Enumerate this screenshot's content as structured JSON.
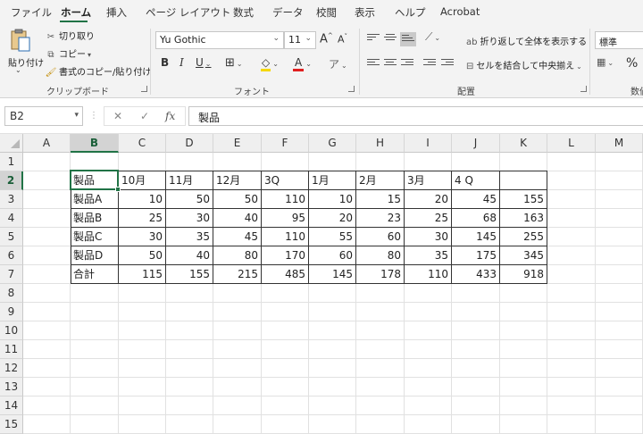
{
  "ribbon_tabs": [
    {
      "label": "ファイル",
      "active": false
    },
    {
      "label": "ホーム",
      "active": true
    },
    {
      "label": "挿入",
      "active": false
    },
    {
      "label": "ページ レイアウト",
      "active": false
    },
    {
      "label": "数式",
      "active": false
    },
    {
      "label": "データ",
      "active": false
    },
    {
      "label": "校閲",
      "active": false
    },
    {
      "label": "表示",
      "active": false
    },
    {
      "label": "ヘルプ",
      "active": false
    },
    {
      "label": "Acrobat",
      "active": false
    }
  ],
  "clipboard": {
    "paste_label": "貼り付け",
    "cut": "切り取り",
    "copy": "コピー",
    "format_painter": "書式のコピー/貼り付け",
    "group_label": "クリップボード"
  },
  "font": {
    "name": "Yu Gothic",
    "size": "11",
    "grow": "A",
    "shrink": "A",
    "bold": "B",
    "italic": "I",
    "underline": "U",
    "color_letter": "A",
    "group_label": "フォント"
  },
  "alignment": {
    "wrap_text": "折り返して全体を表示する",
    "merge_center": "セルを結合して中央揃え",
    "group_label": "配置"
  },
  "number": {
    "format": "標準",
    "percent": "%",
    "group_label": "数値"
  },
  "colors": {
    "accent": "#217346",
    "ribbon_bg": "#f3f3f3",
    "highlight_yellow": "#f5d800",
    "font_red": "#e02020"
  },
  "formula_bar": {
    "name_box": "B2",
    "fx": "fx",
    "content": "製品"
  },
  "grid": {
    "columns": [
      "A",
      "B",
      "C",
      "D",
      "E",
      "F",
      "G",
      "H",
      "I",
      "J",
      "K",
      "L",
      "M"
    ],
    "rows": [
      "1",
      "2",
      "3",
      "4",
      "5",
      "6",
      "7",
      "8",
      "9",
      "10",
      "11",
      "12",
      "13",
      "14",
      "15"
    ],
    "selected_cell": "B2",
    "table_header": [
      "製品",
      "10月",
      "11月",
      "12月",
      "3Q",
      "1月",
      "2月",
      "3月",
      "4 Q",
      ""
    ],
    "table_rows": [
      [
        "製品A",
        "10",
        "50",
        "50",
        "110",
        "10",
        "15",
        "20",
        "45",
        "155"
      ],
      [
        "製品B",
        "25",
        "30",
        "40",
        "95",
        "20",
        "23",
        "25",
        "68",
        "163"
      ],
      [
        "製品C",
        "30",
        "35",
        "45",
        "110",
        "55",
        "60",
        "30",
        "145",
        "255"
      ],
      [
        "製品D",
        "50",
        "40",
        "80",
        "170",
        "60",
        "80",
        "35",
        "175",
        "345"
      ],
      [
        "合計",
        "115",
        "155",
        "215",
        "485",
        "145",
        "178",
        "110",
        "433",
        "918"
      ]
    ]
  }
}
